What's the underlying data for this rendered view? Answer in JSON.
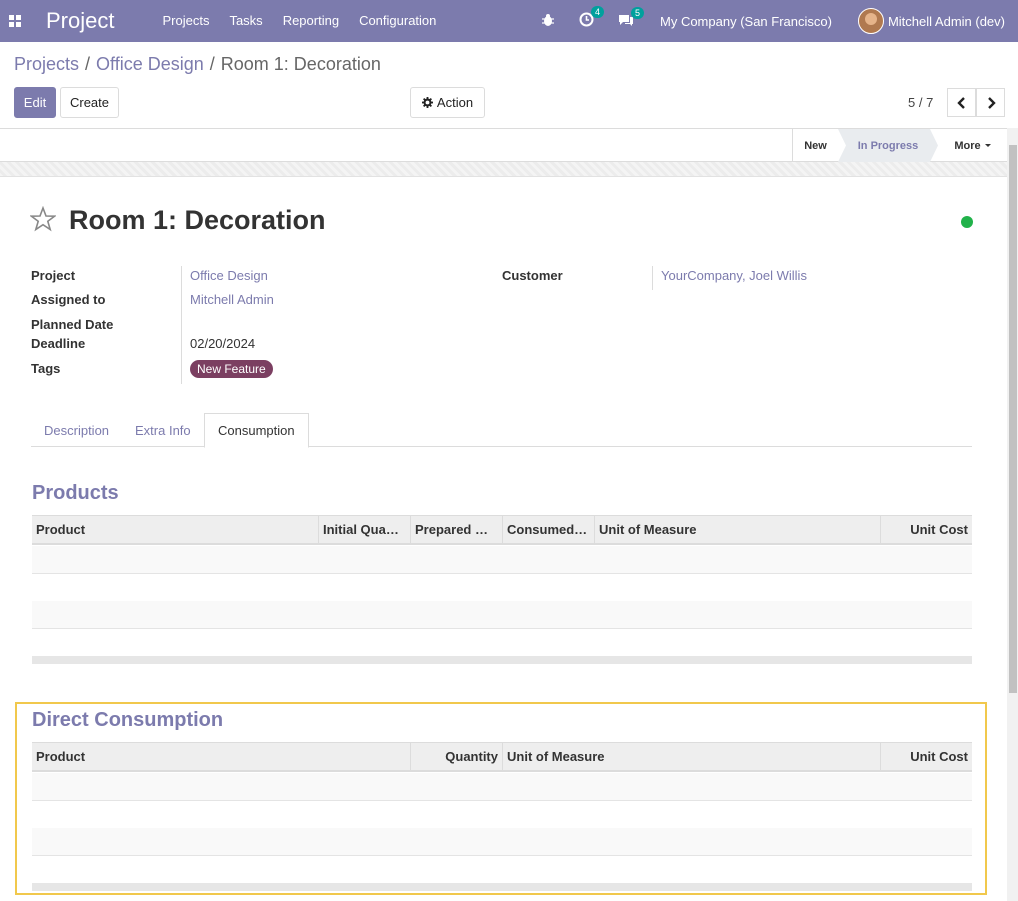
{
  "navbar": {
    "app_name": "Project",
    "menu": [
      "Projects",
      "Tasks",
      "Reporting",
      "Configuration"
    ],
    "activity_count": "4",
    "messages_count": "5",
    "company": "My Company (San Francisco)",
    "user": "Mitchell Admin (dev)"
  },
  "breadcrumb": {
    "projects": "Projects",
    "project": "Office Design",
    "current": "Room 1: Decoration",
    "sep": "/"
  },
  "buttons": {
    "edit": "Edit",
    "create": "Create",
    "action": "Action"
  },
  "pager": "5 / 7",
  "statusbar": {
    "stage_new": "New",
    "stage_in_progress": "In Progress",
    "more": "More"
  },
  "record": {
    "title": "Room 1: Decoration",
    "project_label": "Project",
    "project_value": "Office Design",
    "assigned_label": "Assigned to",
    "assigned_value": "Mitchell Admin",
    "planned_label": "Planned Date",
    "deadline_label": "Deadline",
    "deadline_value": "02/20/2024",
    "tags_label": "Tags",
    "tag": "New Feature",
    "customer_label": "Customer",
    "customer_value": "YourCompany, Joel Willis"
  },
  "tabs": [
    "Description",
    "Extra Info",
    "Consumption"
  ],
  "products": {
    "title": "Products",
    "columns": [
      "Product",
      "Initial Quan…",
      "Prepared Q…",
      "Consumed …",
      "Unit of Measure",
      "Unit Cost"
    ]
  },
  "direct": {
    "title": "Direct Consumption",
    "columns": [
      "Product",
      "Quantity",
      "Unit of Measure",
      "Unit Cost"
    ]
  },
  "colors": {
    "primary": "#7c7bad",
    "tag": "#7b3f61",
    "status_green": "#21b24a",
    "highlight": "#f1c84c"
  }
}
